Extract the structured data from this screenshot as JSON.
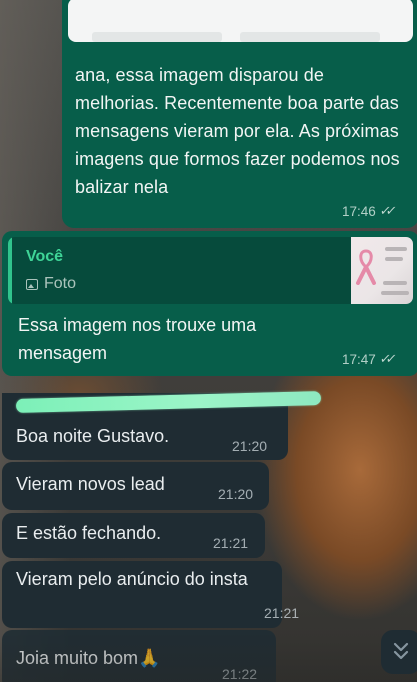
{
  "messages_outgoing": [
    {
      "text": "ana, essa imagem disparou de melhorias. Recentemente boa parte das mensagens vieram por ela. As próximas imagens que formos fazer podemos nos balizar nela",
      "time": "17:46",
      "status_icon": "double-check-icon"
    },
    {
      "quote": {
        "author": "Você",
        "type_label": "Foto",
        "icon": "photo-icon",
        "thumbnail": "pink-ribbon-image"
      },
      "text": "Essa imagem nos trouxe uma mensagem",
      "time": "17:47",
      "status_icon": "double-check-icon"
    }
  ],
  "messages_incoming": [
    {
      "text": "Boa noite Gustavo.",
      "time": "21:20"
    },
    {
      "text": "Vieram novos lead",
      "time": "21:20"
    },
    {
      "text": "E estão fechando.",
      "time": "21:21"
    },
    {
      "text": "Vieram pelo anúncio do insta",
      "time": "21:21"
    },
    {
      "text": "Joia muito bom🙏",
      "time": "21:22"
    }
  ],
  "scroll_button": {
    "icon": "double-chevron-down-icon"
  },
  "colors": {
    "outgoing_bubble": "#075e4a",
    "incoming_bubble": "#1f2c33",
    "quote_accent": "#31c48d",
    "redaction_highlight": "#7cf0b8"
  }
}
